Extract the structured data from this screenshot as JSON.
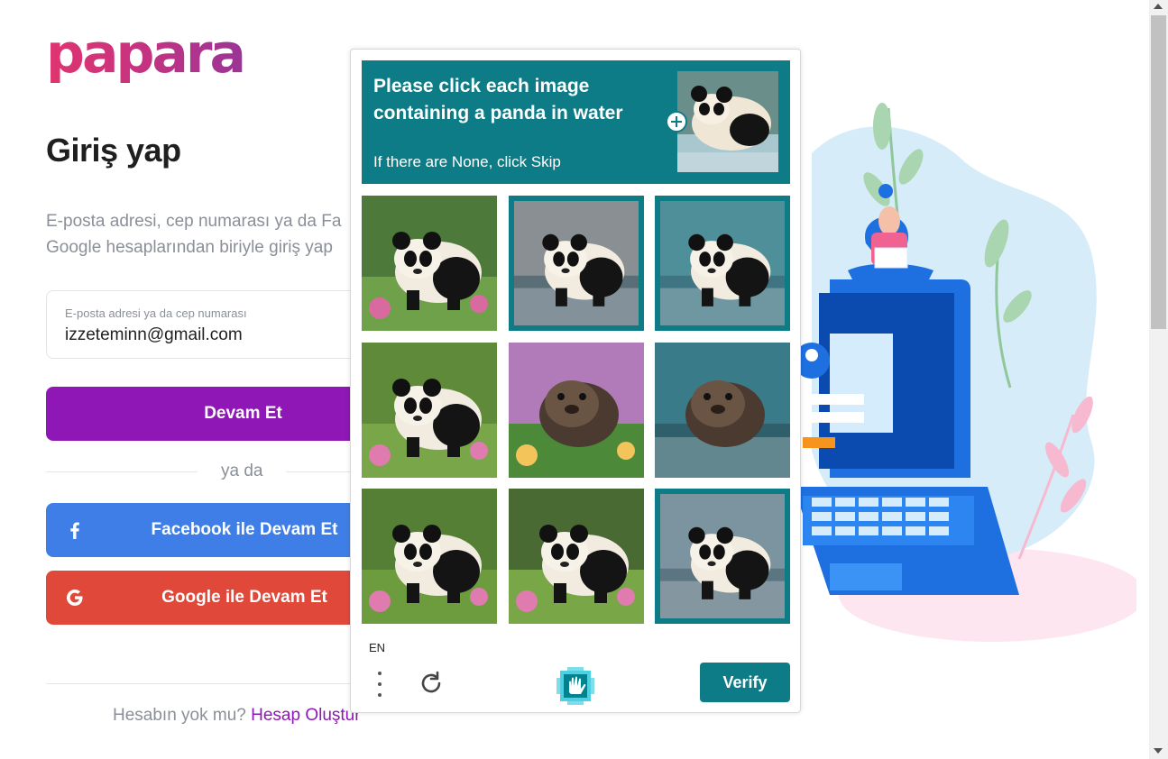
{
  "brand": {
    "logo_text": "papara"
  },
  "login": {
    "title": "Giriş yap",
    "description_line1": "E-posta adresi, cep numarası ya da Fa",
    "description_line2": "Google hesaplarından biriyle giriş yap",
    "email_field": {
      "label": "E-posta adresi ya da cep numarası",
      "value": "izzeteminn@gmail.com"
    },
    "continue_label": "Devam Et",
    "or_label": "ya da",
    "facebook_label": "Facebook ile Devam Et",
    "google_label": "Google ile Devam Et",
    "signup_prompt": "Hesabın yok mu?",
    "signup_link": "Hesap Oluştur"
  },
  "captcha": {
    "prompt": "Please click each image containing a panda in water",
    "sub_prompt": "If there are None, click Skip",
    "example_icon": "panda-in-water-example-icon",
    "tiles": [
      {
        "subject": "panda in garden",
        "selected": false
      },
      {
        "subject": "panda in water",
        "selected": true
      },
      {
        "subject": "panda in water",
        "selected": true
      },
      {
        "subject": "panda in flowers",
        "selected": false
      },
      {
        "subject": "otter in flowers",
        "selected": false
      },
      {
        "subject": "seal in water",
        "selected": false
      },
      {
        "subject": "panda in grass",
        "selected": false
      },
      {
        "subject": "panda on lawn",
        "selected": false
      },
      {
        "subject": "panda in water",
        "selected": true
      }
    ],
    "language": "EN",
    "verify_label": "Verify"
  },
  "colors": {
    "brand_purple": "#8e17b5",
    "facebook_blue": "#3f7ee6",
    "google_red": "#e0483a",
    "captcha_teal": "#0e7c86"
  }
}
